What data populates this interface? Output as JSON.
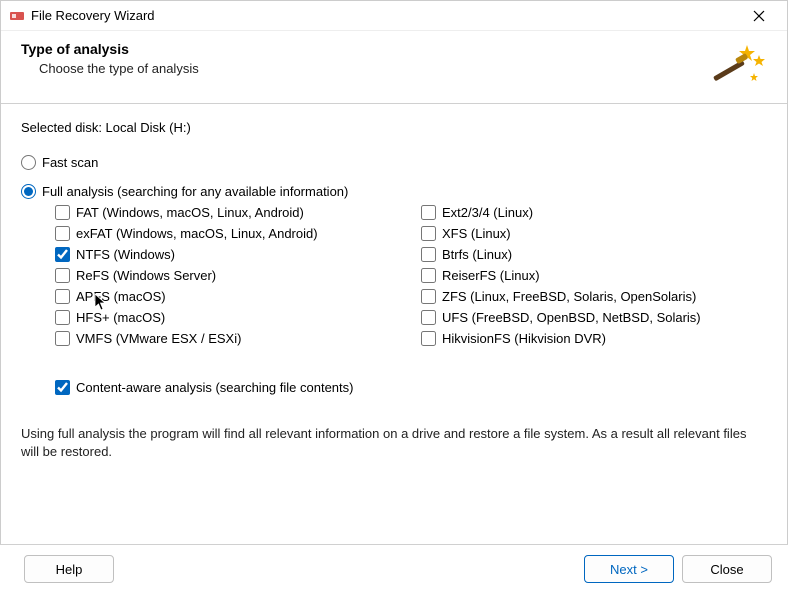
{
  "window": {
    "title": "File Recovery Wizard"
  },
  "header": {
    "title": "Type of analysis",
    "subtitle": "Choose the type of analysis"
  },
  "selected_disk_label": "Selected disk: Local Disk (H:)",
  "scan_options": {
    "fast": "Fast scan",
    "full": "Full analysis (searching for any available information)"
  },
  "filesystems": {
    "left": [
      {
        "key": "fat",
        "label": "FAT (Windows, macOS, Linux, Android)",
        "checked": false
      },
      {
        "key": "exfat",
        "label": "exFAT (Windows, macOS, Linux, Android)",
        "checked": false
      },
      {
        "key": "ntfs",
        "label": "NTFS (Windows)",
        "checked": true
      },
      {
        "key": "refs",
        "label": "ReFS (Windows Server)",
        "checked": false
      },
      {
        "key": "apfs",
        "label": "APFS (macOS)",
        "checked": false
      },
      {
        "key": "hfs",
        "label": "HFS+ (macOS)",
        "checked": false
      },
      {
        "key": "vmfs",
        "label": "VMFS (VMware ESX / ESXi)",
        "checked": false
      }
    ],
    "right": [
      {
        "key": "ext",
        "label": "Ext2/3/4 (Linux)",
        "checked": false
      },
      {
        "key": "xfs",
        "label": "XFS (Linux)",
        "checked": false
      },
      {
        "key": "btrfs",
        "label": "Btrfs (Linux)",
        "checked": false
      },
      {
        "key": "reiserfs",
        "label": "ReiserFS (Linux)",
        "checked": false
      },
      {
        "key": "zfs",
        "label": "ZFS (Linux, FreeBSD, Solaris, OpenSolaris)",
        "checked": false
      },
      {
        "key": "ufs",
        "label": "UFS (FreeBSD, OpenBSD, NetBSD, Solaris)",
        "checked": false
      },
      {
        "key": "hik",
        "label": "HikvisionFS (Hikvision DVR)",
        "checked": false
      }
    ]
  },
  "content_aware": {
    "label": "Content-aware analysis (searching file contents)",
    "checked": true
  },
  "description": "Using full analysis the program will find all relevant information on a drive and restore a file system. As a result all relevant files will be restored.",
  "buttons": {
    "help": "Help",
    "next": "Next >",
    "close": "Close"
  },
  "colors": {
    "accent": "#0067c0"
  }
}
